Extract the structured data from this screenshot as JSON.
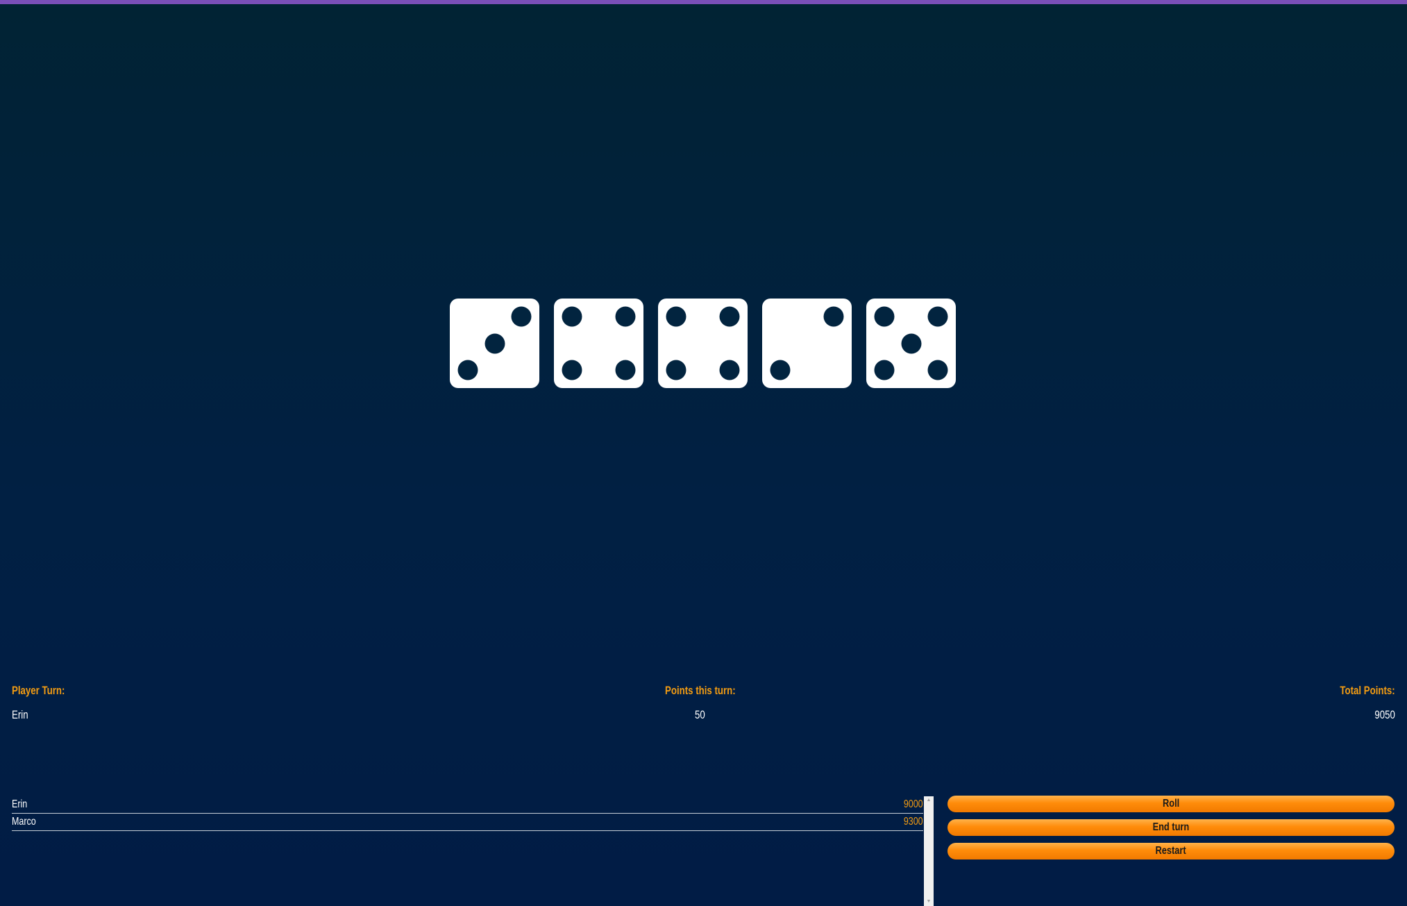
{
  "dice": [
    3,
    4,
    4,
    2,
    5
  ],
  "status": {
    "player_turn_label": "Player Turn:",
    "player_turn_value": "Erin",
    "points_this_turn_label": "Points this turn:",
    "points_this_turn_value": "50",
    "total_points_label": "Total Points:",
    "total_points_value": "9050"
  },
  "scoreboard": [
    {
      "name": "Erin",
      "points": "9000"
    },
    {
      "name": "Marco",
      "points": "9300"
    }
  ],
  "buttons": {
    "roll": "Roll",
    "end_turn": "End turn",
    "restart": "Restart"
  },
  "colors": {
    "accent": "#f39c12",
    "button": "#ff8c0a",
    "background": "#012043",
    "top_bar": "#7a4fb8"
  }
}
